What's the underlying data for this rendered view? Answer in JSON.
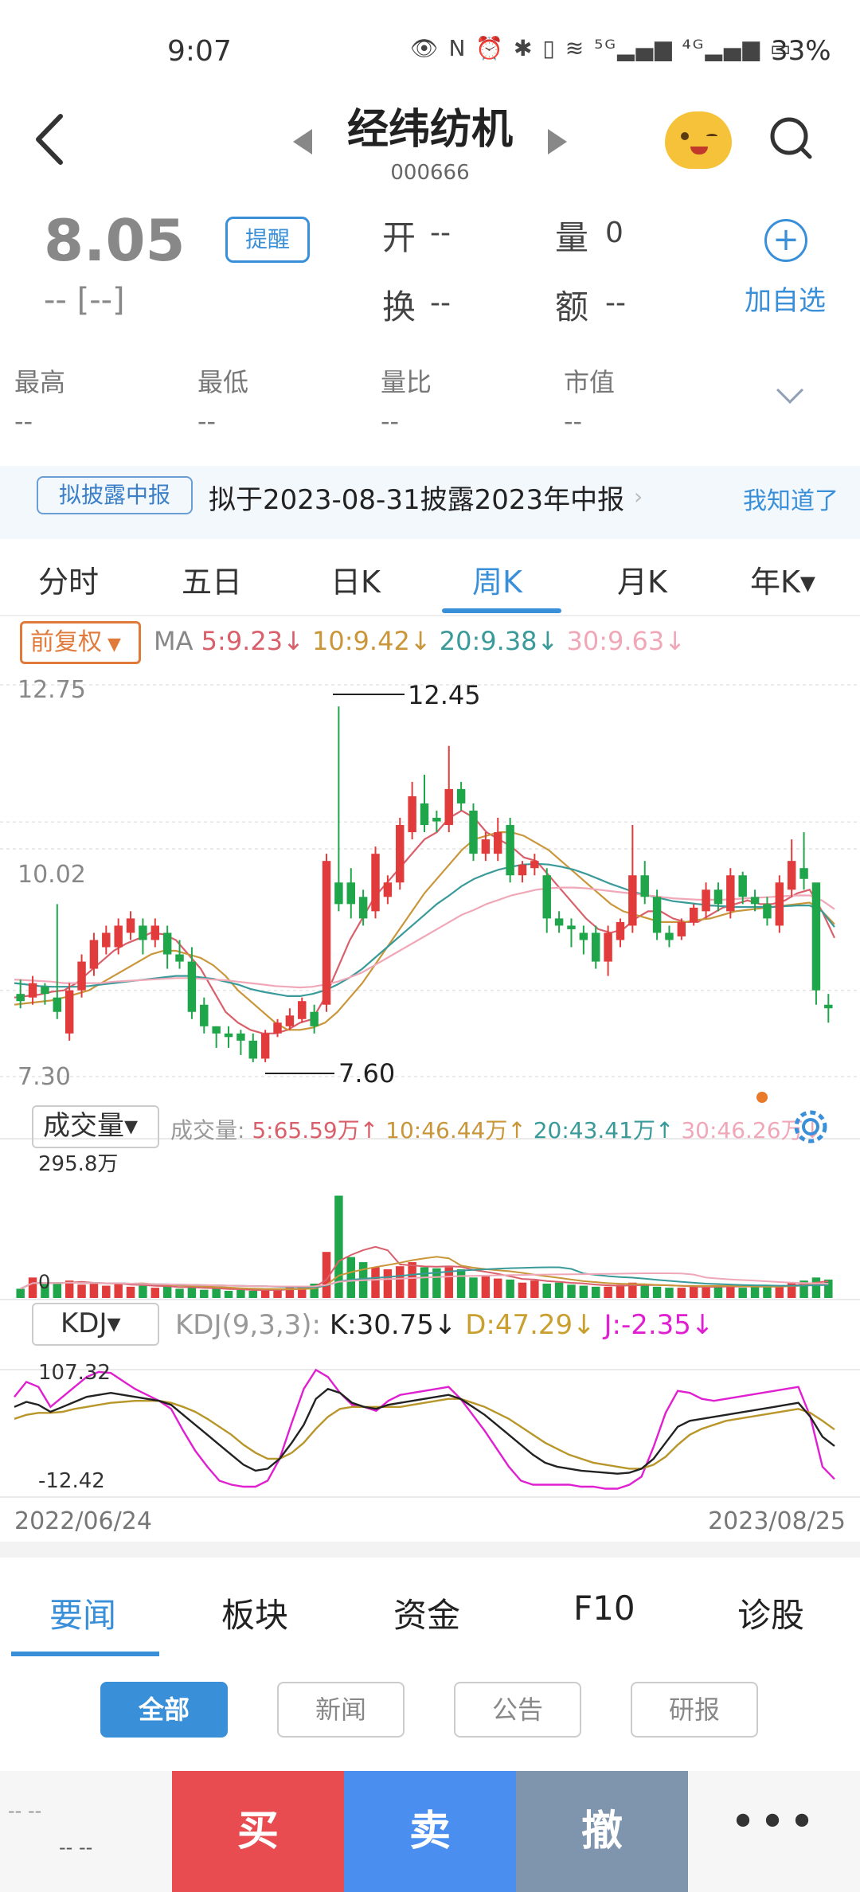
{
  "status": {
    "time": "9:07",
    "icons_text": "👁 N ⏰ ✱ ▯ ≋ ⁵ᴳ▂▄▆ ⁴ᴳ▂▄▆ ▭",
    "battery": "33%"
  },
  "header": {
    "title": "经纬纺机",
    "code": "000666"
  },
  "quote": {
    "price": "8.05",
    "change": "-- [--]",
    "remind_label": "提醒",
    "open_label": "开",
    "open_value": "--",
    "volume_label": "量",
    "volume_value": "0",
    "turnover_label": "换",
    "turnover_value": "--",
    "amount_label": "额",
    "amount_value": "--",
    "add_label": "加自选",
    "stats": [
      {
        "label": "最高",
        "value": "--"
      },
      {
        "label": "最低",
        "value": "--"
      },
      {
        "label": "量比",
        "value": "--"
      },
      {
        "label": "市值",
        "value": "--"
      }
    ]
  },
  "notice": {
    "tag": "拟披露中报",
    "text": "拟于2023-08-31披露2023年中报",
    "action": "我知道了"
  },
  "period_tabs": [
    "分时",
    "五日",
    "日K",
    "周K",
    "月K",
    "年K▾"
  ],
  "ma": {
    "adjust_label": "前复权",
    "label": "MA",
    "items": [
      {
        "text": "5:9.23↓",
        "color": "#d9606b"
      },
      {
        "text": "10:9.42↓",
        "color": "#c9963a"
      },
      {
        "text": "20:9.38↓",
        "color": "#3a9a9a"
      },
      {
        "text": "30:9.63↓",
        "color": "#f0a8b8"
      }
    ]
  },
  "volume_panel": {
    "selector": "成交量▾",
    "label": "成交量:",
    "items": [
      {
        "text": "5:65.59万↑",
        "color": "#d9606b"
      },
      {
        "text": "10:46.44万↑",
        "color": "#c9963a"
      },
      {
        "text": "20:43.41万↑",
        "color": "#3a9a9a"
      },
      {
        "text": "30:46.26万↓",
        "color": "#f0a8b8"
      }
    ]
  },
  "kdj_panel": {
    "selector": "KDJ▾",
    "params": "KDJ(9,3,3):",
    "k": "K:30.75↓",
    "d": "D:47.29↓",
    "j": "J:-2.35↓"
  },
  "chart_data": {
    "type": "candlestick",
    "price_axis": {
      "top": "12.75",
      "mid": "10.02",
      "bottom": "7.30",
      "ylim": [
        7.3,
        12.75
      ]
    },
    "annotations": {
      "high": "12.45",
      "low": "7.60"
    },
    "date_start": "2022/06/24",
    "date_end": "2023/08/25",
    "candles": [
      {
        "o": 8.45,
        "c": 8.35,
        "h": 8.65,
        "l": 8.25
      },
      {
        "o": 8.4,
        "c": 8.6,
        "h": 8.7,
        "l": 8.3
      },
      {
        "o": 8.55,
        "c": 8.45,
        "h": 8.6,
        "l": 8.3
      },
      {
        "o": 8.4,
        "c": 8.2,
        "h": 9.7,
        "l": 8.1
      },
      {
        "o": 7.9,
        "c": 8.5,
        "h": 8.6,
        "l": 7.8
      },
      {
        "o": 8.5,
        "c": 8.9,
        "h": 9.0,
        "l": 8.4
      },
      {
        "o": 8.8,
        "c": 9.2,
        "h": 9.3,
        "l": 8.7
      },
      {
        "o": 9.1,
        "c": 9.3,
        "h": 9.4,
        "l": 9.0
      },
      {
        "o": 9.1,
        "c": 9.4,
        "h": 9.5,
        "l": 9.0
      },
      {
        "o": 9.3,
        "c": 9.5,
        "h": 9.6,
        "l": 9.2
      },
      {
        "o": 9.4,
        "c": 9.2,
        "h": 9.5,
        "l": 9.0
      },
      {
        "o": 9.2,
        "c": 9.4,
        "h": 9.5,
        "l": 9.1
      },
      {
        "o": 9.3,
        "c": 9.0,
        "h": 9.4,
        "l": 8.8
      },
      {
        "o": 9.0,
        "c": 8.9,
        "h": 9.2,
        "l": 8.8
      },
      {
        "o": 8.9,
        "c": 8.2,
        "h": 9.1,
        "l": 8.1
      },
      {
        "o": 8.3,
        "c": 8.0,
        "h": 8.4,
        "l": 7.9
      },
      {
        "o": 8.0,
        "c": 7.9,
        "h": 8.0,
        "l": 7.7
      },
      {
        "o": 7.9,
        "c": 7.85,
        "h": 8.0,
        "l": 7.7
      },
      {
        "o": 7.9,
        "c": 7.8,
        "h": 7.95,
        "l": 7.6
      },
      {
        "o": 7.8,
        "c": 7.55,
        "h": 7.9,
        "l": 7.5
      },
      {
        "o": 7.55,
        "c": 7.9,
        "h": 7.95,
        "l": 7.5
      },
      {
        "o": 7.9,
        "c": 8.05,
        "h": 8.1,
        "l": 7.85
      },
      {
        "o": 8.0,
        "c": 8.15,
        "h": 8.25,
        "l": 7.95
      },
      {
        "o": 8.1,
        "c": 8.35,
        "h": 8.4,
        "l": 8.05
      },
      {
        "o": 8.2,
        "c": 8.0,
        "h": 8.3,
        "l": 7.9
      },
      {
        "o": 8.3,
        "c": 10.3,
        "h": 10.4,
        "l": 8.2
      },
      {
        "o": 10.0,
        "c": 9.7,
        "h": 12.45,
        "l": 9.6
      },
      {
        "o": 10.0,
        "c": 9.7,
        "h": 10.2,
        "l": 9.5
      },
      {
        "o": 9.8,
        "c": 9.5,
        "h": 9.9,
        "l": 9.4
      },
      {
        "o": 9.6,
        "c": 10.4,
        "h": 10.5,
        "l": 9.5
      },
      {
        "o": 9.8,
        "c": 10.0,
        "h": 10.1,
        "l": 9.7
      },
      {
        "o": 10.0,
        "c": 10.8,
        "h": 10.9,
        "l": 9.9
      },
      {
        "o": 10.7,
        "c": 11.2,
        "h": 11.4,
        "l": 10.6
      },
      {
        "o": 11.1,
        "c": 10.8,
        "h": 11.5,
        "l": 10.7
      },
      {
        "o": 10.9,
        "c": 10.85,
        "h": 11.0,
        "l": 10.7
      },
      {
        "o": 10.8,
        "c": 11.3,
        "h": 11.9,
        "l": 10.7
      },
      {
        "o": 11.3,
        "c": 11.1,
        "h": 11.4,
        "l": 11.0
      },
      {
        "o": 11.0,
        "c": 10.4,
        "h": 11.1,
        "l": 10.3
      },
      {
        "o": 10.4,
        "c": 10.6,
        "h": 10.7,
        "l": 10.3
      },
      {
        "o": 10.4,
        "c": 10.7,
        "h": 10.9,
        "l": 10.3
      },
      {
        "o": 10.8,
        "c": 10.1,
        "h": 10.9,
        "l": 10.0
      },
      {
        "o": 10.1,
        "c": 10.25,
        "h": 10.3,
        "l": 10.0
      },
      {
        "o": 10.2,
        "c": 10.3,
        "h": 10.4,
        "l": 10.1
      },
      {
        "o": 10.1,
        "c": 9.5,
        "h": 10.2,
        "l": 9.3
      },
      {
        "o": 9.5,
        "c": 9.4,
        "h": 9.6,
        "l": 9.3
      },
      {
        "o": 9.4,
        "c": 9.35,
        "h": 9.5,
        "l": 9.1
      },
      {
        "o": 9.3,
        "c": 9.2,
        "h": 9.4,
        "l": 9.0
      },
      {
        "o": 9.3,
        "c": 8.9,
        "h": 9.4,
        "l": 8.8
      },
      {
        "o": 8.9,
        "c": 9.3,
        "h": 9.4,
        "l": 8.7
      },
      {
        "o": 9.2,
        "c": 9.45,
        "h": 9.5,
        "l": 9.1
      },
      {
        "o": 9.4,
        "c": 10.1,
        "h": 10.8,
        "l": 9.3
      },
      {
        "o": 10.1,
        "c": 9.8,
        "h": 10.3,
        "l": 9.7
      },
      {
        "o": 9.8,
        "c": 9.3,
        "h": 9.9,
        "l": 9.2
      },
      {
        "o": 9.3,
        "c": 9.2,
        "h": 9.4,
        "l": 9.1
      },
      {
        "o": 9.25,
        "c": 9.45,
        "h": 9.5,
        "l": 9.2
      },
      {
        "o": 9.45,
        "c": 9.65,
        "h": 9.7,
        "l": 9.4
      },
      {
        "o": 9.6,
        "c": 9.9,
        "h": 10.0,
        "l": 9.5
      },
      {
        "o": 9.9,
        "c": 9.7,
        "h": 10.0,
        "l": 9.6
      },
      {
        "o": 9.6,
        "c": 10.1,
        "h": 10.2,
        "l": 9.5
      },
      {
        "o": 10.1,
        "c": 9.8,
        "h": 10.15,
        "l": 9.7
      },
      {
        "o": 9.8,
        "c": 9.7,
        "h": 9.9,
        "l": 9.6
      },
      {
        "o": 9.7,
        "c": 9.5,
        "h": 9.8,
        "l": 9.4
      },
      {
        "o": 9.4,
        "c": 10.0,
        "h": 10.1,
        "l": 9.3
      },
      {
        "o": 9.9,
        "c": 10.3,
        "h": 10.6,
        "l": 9.8
      },
      {
        "o": 10.2,
        "c": 10.05,
        "h": 10.7,
        "l": 9.9
      },
      {
        "o": 10.0,
        "c": 8.5,
        "h": 9.0,
        "l": 8.3
      },
      {
        "o": 8.3,
        "c": 8.25,
        "h": 8.45,
        "l": 8.05
      }
    ],
    "ma_lines": {
      "ma5": [
        8.4,
        8.42,
        8.44,
        8.48,
        8.5,
        8.6,
        8.75,
        8.9,
        9.05,
        9.15,
        9.22,
        9.3,
        9.28,
        9.2,
        9.0,
        8.8,
        8.5,
        8.2,
        8.05,
        7.95,
        7.9,
        7.9,
        7.95,
        8.05,
        8.1,
        8.4,
        8.8,
        9.2,
        9.5,
        9.8,
        10.0,
        10.2,
        10.4,
        10.6,
        10.7,
        10.9,
        11.0,
        10.9,
        10.7,
        10.6,
        10.5,
        10.35,
        10.3,
        10.1,
        9.9,
        9.7,
        9.5,
        9.35,
        9.3,
        9.35,
        9.5,
        9.6,
        9.6,
        9.5,
        9.45,
        9.45,
        9.55,
        9.65,
        9.7,
        9.75,
        9.7,
        9.7,
        9.75,
        9.85,
        9.9,
        9.6,
        9.23
      ],
      "ma10": [
        8.3,
        8.32,
        8.34,
        8.36,
        8.4,
        8.45,
        8.5,
        8.6,
        8.7,
        8.8,
        8.9,
        9.0,
        9.05,
        9.05,
        9.0,
        8.95,
        8.85,
        8.7,
        8.5,
        8.35,
        8.2,
        8.05,
        7.95,
        7.95,
        7.98,
        8.05,
        8.2,
        8.4,
        8.6,
        8.85,
        9.1,
        9.35,
        9.6,
        9.85,
        10.05,
        10.25,
        10.45,
        10.6,
        10.65,
        10.7,
        10.7,
        10.65,
        10.55,
        10.45,
        10.3,
        10.15,
        10.0,
        9.85,
        9.7,
        9.6,
        9.55,
        9.5,
        9.45,
        9.45,
        9.45,
        9.48,
        9.5,
        9.55,
        9.6,
        9.62,
        9.64,
        9.66,
        9.68,
        9.7,
        9.72,
        9.6,
        9.42
      ],
      "ma20": [
        8.6,
        8.58,
        8.56,
        8.55,
        8.55,
        8.55,
        8.56,
        8.58,
        8.6,
        8.62,
        8.64,
        8.66,
        8.68,
        8.7,
        8.7,
        8.68,
        8.66,
        8.62,
        8.58,
        8.52,
        8.48,
        8.45,
        8.42,
        8.42,
        8.45,
        8.5,
        8.58,
        8.68,
        8.8,
        8.95,
        9.1,
        9.25,
        9.4,
        9.55,
        9.7,
        9.82,
        9.95,
        10.05,
        10.12,
        10.18,
        10.22,
        10.25,
        10.26,
        10.25,
        10.22,
        10.18,
        10.12,
        10.05,
        9.98,
        9.92,
        9.86,
        9.82,
        9.78,
        9.74,
        9.72,
        9.7,
        9.68,
        9.67,
        9.66,
        9.66,
        9.66,
        9.66,
        9.67,
        9.68,
        9.68,
        9.6,
        9.38
      ],
      "ma30": [
        8.65,
        8.64,
        8.63,
        8.62,
        8.6,
        8.6,
        8.6,
        8.6,
        8.62,
        8.63,
        8.64,
        8.65,
        8.66,
        8.67,
        8.67,
        8.66,
        8.65,
        8.64,
        8.62,
        8.6,
        8.58,
        8.56,
        8.55,
        8.54,
        8.55,
        8.58,
        8.62,
        8.68,
        8.75,
        8.85,
        8.95,
        9.05,
        9.15,
        9.25,
        9.35,
        9.45,
        9.55,
        9.62,
        9.7,
        9.76,
        9.82,
        9.86,
        9.9,
        9.92,
        9.93,
        9.93,
        9.92,
        9.9,
        9.88,
        9.86,
        9.84,
        9.82,
        9.8,
        9.78,
        9.77,
        9.76,
        9.76,
        9.76,
        9.77,
        9.78,
        9.79,
        9.8,
        9.81,
        9.82,
        9.82,
        9.75,
        9.63
      ]
    },
    "volume_axis": {
      "top": "295.8万",
      "bottom": "0",
      "ylim": [
        0,
        295.8
      ]
    },
    "volume": [
      18,
      40,
      30,
      28,
      34,
      26,
      30,
      24,
      28,
      22,
      24,
      20,
      22,
      18,
      22,
      16,
      18,
      14,
      16,
      14,
      16,
      18,
      20,
      22,
      28,
      90,
      200,
      80,
      70,
      60,
      56,
      62,
      70,
      60,
      58,
      60,
      56,
      40,
      42,
      38,
      36,
      30,
      34,
      28,
      30,
      26,
      24,
      22,
      22,
      26,
      30,
      26,
      22,
      20,
      20,
      24,
      22,
      24,
      22,
      20,
      24,
      22,
      24,
      30,
      34,
      40,
      36
    ],
    "kdj_axis": {
      "top": "107.32",
      "bottom": "-12.42",
      "ylim": [
        -12.42,
        107.32
      ]
    },
    "kdj": {
      "k": [
        70,
        75,
        72,
        65,
        70,
        75,
        80,
        82,
        84,
        82,
        80,
        78,
        76,
        72,
        62,
        52,
        42,
        32,
        22,
        12,
        6,
        8,
        18,
        34,
        52,
        78,
        88,
        84,
        74,
        70,
        68,
        72,
        74,
        76,
        78,
        80,
        82,
        78,
        70,
        62,
        52,
        42,
        32,
        22,
        14,
        10,
        8,
        6,
        5,
        4,
        3,
        4,
        8,
        18,
        34,
        50,
        56,
        58,
        60,
        62,
        64,
        66,
        68,
        70,
        72,
        74,
        60,
        40,
        30.75
      ],
      "d": [
        58,
        62,
        64,
        64,
        65,
        68,
        70,
        72,
        74,
        75,
        76,
        76,
        76,
        74,
        70,
        65,
        58,
        50,
        42,
        32,
        24,
        18,
        18,
        24,
        34,
        48,
        60,
        68,
        70,
        70,
        70,
        70,
        70,
        72,
        74,
        76,
        78,
        78,
        74,
        70,
        64,
        58,
        50,
        42,
        34,
        28,
        22,
        18,
        14,
        12,
        10,
        8,
        8,
        12,
        20,
        32,
        42,
        48,
        52,
        56,
        58,
        60,
        62,
        64,
        66,
        68,
        64,
        56,
        47.29
      ],
      "j": [
        80,
        95,
        90,
        70,
        80,
        90,
        100,
        105,
        104,
        96,
        88,
        82,
        76,
        68,
        46,
        26,
        10,
        -4,
        -8,
        -10,
        -10,
        -4,
        18,
        54,
        88,
        107,
        100,
        84,
        72,
        70,
        66,
        76,
        82,
        84,
        86,
        88,
        90,
        78,
        62,
        46,
        28,
        10,
        -4,
        -8,
        -8,
        -8,
        -8,
        -10,
        -10,
        -12,
        -12,
        -8,
        0,
        30,
        64,
        86,
        84,
        78,
        76,
        78,
        80,
        82,
        84,
        86,
        88,
        90,
        60,
        10,
        -2.35
      ]
    }
  },
  "news_tabs": [
    "要闻",
    "板块",
    "资金",
    "F10",
    "诊股"
  ],
  "news_filters": [
    "全部",
    "新闻",
    "公告",
    "研报"
  ],
  "trade_bar": {
    "left_top": "-- --",
    "left_bottom": "-- --",
    "buy": "买",
    "sell": "卖",
    "cancel": "撤",
    "more": "•••",
    "buy_color": "#e84c50",
    "sell_color": "#4a8ef0",
    "cancel_color": "#7f95ad"
  },
  "colors": {
    "accent": "#3a8fd9",
    "up": "#e23b3b",
    "down": "#1fa64a"
  }
}
